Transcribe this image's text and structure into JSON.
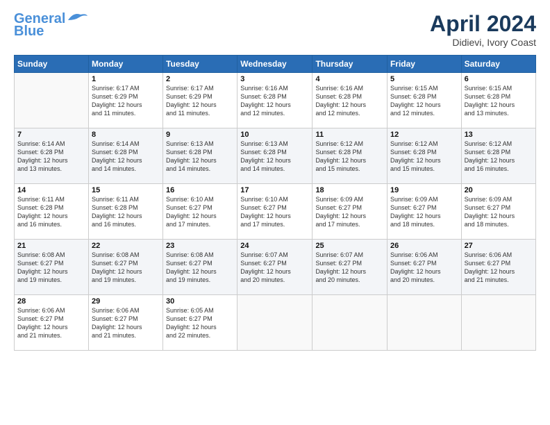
{
  "header": {
    "logo_line1": "General",
    "logo_line2": "Blue",
    "main_title": "April 2024",
    "subtitle": "Didievi, Ivory Coast"
  },
  "weekdays": [
    "Sunday",
    "Monday",
    "Tuesday",
    "Wednesday",
    "Thursday",
    "Friday",
    "Saturday"
  ],
  "weeks": [
    [
      {
        "num": "",
        "info": ""
      },
      {
        "num": "1",
        "info": "Sunrise: 6:17 AM\nSunset: 6:29 PM\nDaylight: 12 hours\nand 11 minutes."
      },
      {
        "num": "2",
        "info": "Sunrise: 6:17 AM\nSunset: 6:29 PM\nDaylight: 12 hours\nand 11 minutes."
      },
      {
        "num": "3",
        "info": "Sunrise: 6:16 AM\nSunset: 6:28 PM\nDaylight: 12 hours\nand 12 minutes."
      },
      {
        "num": "4",
        "info": "Sunrise: 6:16 AM\nSunset: 6:28 PM\nDaylight: 12 hours\nand 12 minutes."
      },
      {
        "num": "5",
        "info": "Sunrise: 6:15 AM\nSunset: 6:28 PM\nDaylight: 12 hours\nand 12 minutes."
      },
      {
        "num": "6",
        "info": "Sunrise: 6:15 AM\nSunset: 6:28 PM\nDaylight: 12 hours\nand 13 minutes."
      }
    ],
    [
      {
        "num": "7",
        "info": "Sunrise: 6:14 AM\nSunset: 6:28 PM\nDaylight: 12 hours\nand 13 minutes."
      },
      {
        "num": "8",
        "info": "Sunrise: 6:14 AM\nSunset: 6:28 PM\nDaylight: 12 hours\nand 14 minutes."
      },
      {
        "num": "9",
        "info": "Sunrise: 6:13 AM\nSunset: 6:28 PM\nDaylight: 12 hours\nand 14 minutes."
      },
      {
        "num": "10",
        "info": "Sunrise: 6:13 AM\nSunset: 6:28 PM\nDaylight: 12 hours\nand 14 minutes."
      },
      {
        "num": "11",
        "info": "Sunrise: 6:12 AM\nSunset: 6:28 PM\nDaylight: 12 hours\nand 15 minutes."
      },
      {
        "num": "12",
        "info": "Sunrise: 6:12 AM\nSunset: 6:28 PM\nDaylight: 12 hours\nand 15 minutes."
      },
      {
        "num": "13",
        "info": "Sunrise: 6:12 AM\nSunset: 6:28 PM\nDaylight: 12 hours\nand 16 minutes."
      }
    ],
    [
      {
        "num": "14",
        "info": "Sunrise: 6:11 AM\nSunset: 6:28 PM\nDaylight: 12 hours\nand 16 minutes."
      },
      {
        "num": "15",
        "info": "Sunrise: 6:11 AM\nSunset: 6:28 PM\nDaylight: 12 hours\nand 16 minutes."
      },
      {
        "num": "16",
        "info": "Sunrise: 6:10 AM\nSunset: 6:27 PM\nDaylight: 12 hours\nand 17 minutes."
      },
      {
        "num": "17",
        "info": "Sunrise: 6:10 AM\nSunset: 6:27 PM\nDaylight: 12 hours\nand 17 minutes."
      },
      {
        "num": "18",
        "info": "Sunrise: 6:09 AM\nSunset: 6:27 PM\nDaylight: 12 hours\nand 17 minutes."
      },
      {
        "num": "19",
        "info": "Sunrise: 6:09 AM\nSunset: 6:27 PM\nDaylight: 12 hours\nand 18 minutes."
      },
      {
        "num": "20",
        "info": "Sunrise: 6:09 AM\nSunset: 6:27 PM\nDaylight: 12 hours\nand 18 minutes."
      }
    ],
    [
      {
        "num": "21",
        "info": "Sunrise: 6:08 AM\nSunset: 6:27 PM\nDaylight: 12 hours\nand 19 minutes."
      },
      {
        "num": "22",
        "info": "Sunrise: 6:08 AM\nSunset: 6:27 PM\nDaylight: 12 hours\nand 19 minutes."
      },
      {
        "num": "23",
        "info": "Sunrise: 6:08 AM\nSunset: 6:27 PM\nDaylight: 12 hours\nand 19 minutes."
      },
      {
        "num": "24",
        "info": "Sunrise: 6:07 AM\nSunset: 6:27 PM\nDaylight: 12 hours\nand 20 minutes."
      },
      {
        "num": "25",
        "info": "Sunrise: 6:07 AM\nSunset: 6:27 PM\nDaylight: 12 hours\nand 20 minutes."
      },
      {
        "num": "26",
        "info": "Sunrise: 6:06 AM\nSunset: 6:27 PM\nDaylight: 12 hours\nand 20 minutes."
      },
      {
        "num": "27",
        "info": "Sunrise: 6:06 AM\nSunset: 6:27 PM\nDaylight: 12 hours\nand 21 minutes."
      }
    ],
    [
      {
        "num": "28",
        "info": "Sunrise: 6:06 AM\nSunset: 6:27 PM\nDaylight: 12 hours\nand 21 minutes."
      },
      {
        "num": "29",
        "info": "Sunrise: 6:06 AM\nSunset: 6:27 PM\nDaylight: 12 hours\nand 21 minutes."
      },
      {
        "num": "30",
        "info": "Sunrise: 6:05 AM\nSunset: 6:27 PM\nDaylight: 12 hours\nand 22 minutes."
      },
      {
        "num": "",
        "info": ""
      },
      {
        "num": "",
        "info": ""
      },
      {
        "num": "",
        "info": ""
      },
      {
        "num": "",
        "info": ""
      }
    ]
  ]
}
